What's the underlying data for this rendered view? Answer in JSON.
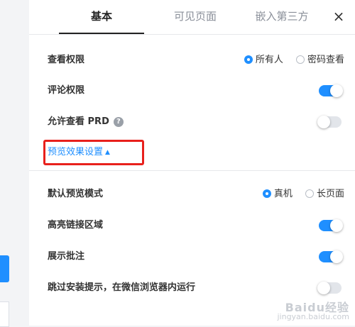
{
  "tabs": [
    {
      "label": "基本",
      "active": true
    },
    {
      "label": "可见页面",
      "active": false
    },
    {
      "label": "嵌入第三方",
      "active": false
    }
  ],
  "close_label": "×",
  "settings": {
    "view_permission": {
      "label": "查看权限",
      "options": [
        "所有人",
        "密码查看"
      ],
      "selected": "所有人"
    },
    "comment_permission": {
      "label": "评论权限",
      "enabled": true
    },
    "allow_view_prd": {
      "label": "允许查看 PRD",
      "help": "?",
      "enabled": false
    }
  },
  "preview_settings": {
    "link_label": "预览效果设置",
    "caret": "▲",
    "default_mode": {
      "label": "默认预览模式",
      "options": [
        "真机",
        "长页面"
      ],
      "selected": "真机"
    },
    "highlight_links": {
      "label": "高亮链接区域",
      "enabled": true
    },
    "show_annotations": {
      "label": "展示批注",
      "enabled": true
    },
    "skip_install_tip": {
      "label": "跳过安装提示，在微信浏览器内运行",
      "enabled": false
    }
  },
  "watermark": {
    "main": "Baidu经验",
    "sub": "jingyan.baidu.com"
  },
  "colors": {
    "accent": "#1f8fff",
    "highlight_box": "#e8201c"
  }
}
